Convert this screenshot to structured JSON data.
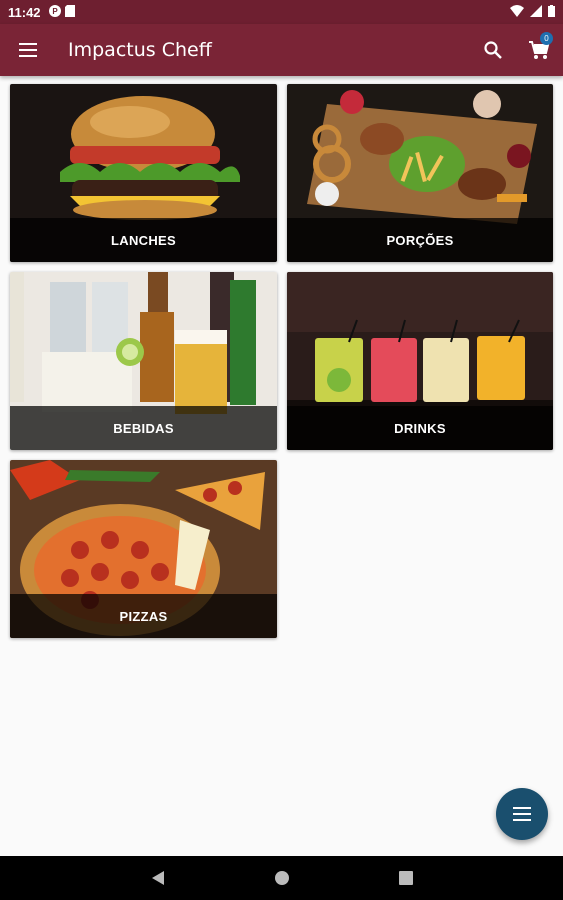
{
  "status_bar": {
    "time": "11:42"
  },
  "app_bar": {
    "title": "Impactus Cheff",
    "cart_count": "0"
  },
  "categories": [
    {
      "label": "LANCHES"
    },
    {
      "label": "PORÇÕES"
    },
    {
      "label": "BEBIDAS"
    },
    {
      "label": "DRINKS"
    },
    {
      "label": "PIZZAS"
    }
  ],
  "colors": {
    "status_bar": "#6e1f30",
    "app_bar": "#7a2436",
    "fab": "#1a4f6e",
    "badge": "#1e6fb0"
  }
}
